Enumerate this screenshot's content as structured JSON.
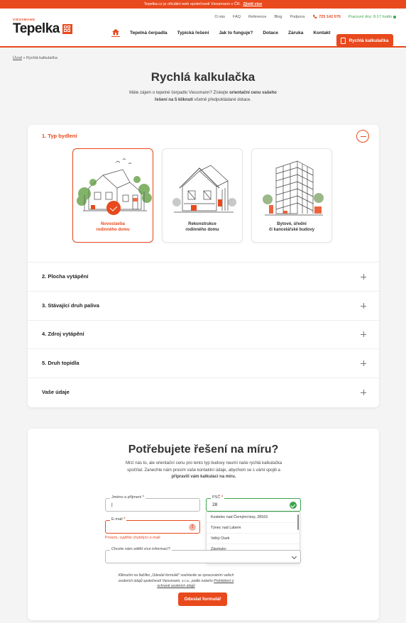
{
  "topbar": {
    "text": "Tepelka.cz je oficiální web společnosti Viessmann v ČR.",
    "link": "Zjistit více"
  },
  "brand": {
    "maker": "VIESSMANN",
    "name": "Tepelka"
  },
  "utility": {
    "items": [
      "O nás",
      "FAQ",
      "Reference",
      "Blog",
      "Podpora"
    ],
    "phone": "725 142 070",
    "hours": "Pracovní dny: 8-17 hodin"
  },
  "nav": {
    "items": [
      "Tepelná čerpadla",
      "Typická řešení",
      "Jak to funguje?",
      "Dotace",
      "Záruka",
      "Kontakt"
    ],
    "cta": "Rychlá kalkulačka"
  },
  "breadcrumb": {
    "home": "Úvod",
    "separator": "»",
    "current": "Rychlá kalkulačka"
  },
  "page": {
    "title": "Rychlá kalkulačka",
    "intro_a": "Máte zájem o tepelné čerpadlo Viessmann? Získejte",
    "intro_b": "orientační cenu vašeho řešení na 5 kliknutí",
    "intro_c": "včetně předpokládané dotace."
  },
  "calculator": {
    "sections": [
      "1. Typ bydlení",
      "2. Plocha vytápění",
      "3. Stávající druh paliva",
      "4. Zdroj vytápění",
      "5. Druh topidla",
      "Vaše údaje"
    ],
    "options": [
      {
        "line1": "Novostavba",
        "line2": "rodinného domu",
        "selected": true
      },
      {
        "line1": "Rekonstrukce",
        "line2": "rodinného domu",
        "selected": false
      },
      {
        "line1": "Bytové, úřední",
        "line2": "či kancelářské budovy",
        "selected": false
      }
    ]
  },
  "form": {
    "title": "Potřebujete řešení na míru?",
    "text_a": "Mrzí nás to, ale orientační cenu pro tento typ budovy neumí naše rychlá kalkulačka spočítat. Zanechte nám prosím vaše kontaktní údaje, abychom se s vámi spojili a",
    "text_b": "připravili vám kalkulaci na míru.",
    "name_label": "Jméno a příjmení",
    "name_value": "|",
    "zip_label": "PSČ",
    "zip_value": "28",
    "email_label": "E-mail",
    "email_error": "Prosím, vyplňte chybějící e-mail",
    "info_label": "Chcete nám sdělit více informací?",
    "suggestions": [
      "Kostelec nad Černými lesy, 28163",
      "Týnec nad Labem",
      "Velký Osek",
      "Zásmuky"
    ],
    "legal_a": "Kliknutím na tlačítko „Odeslat formulář“ souhlasíte se zpracováním vašich osobních údajů společností Viessmann, s.r.o., podle našeho",
    "legal_link": "Prohlášení o ochraně osobních údajů",
    "submit": "Odeslat formulář"
  },
  "colors": {
    "accent": "#e8491d",
    "success": "#3aa54a"
  }
}
